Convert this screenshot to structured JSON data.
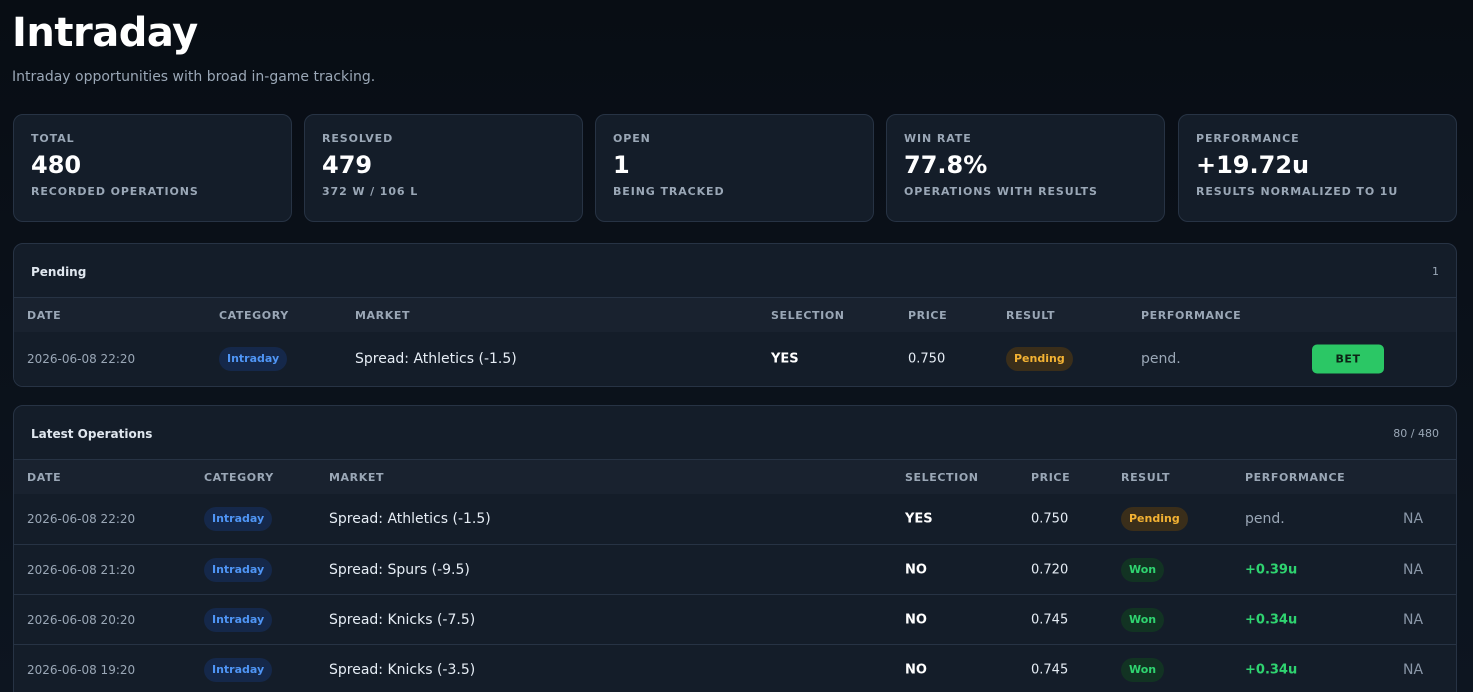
{
  "page": {
    "title": "Intraday",
    "subtitle": "Intraday opportunities with broad in-game tracking."
  },
  "stats": [
    {
      "label": "TOTAL",
      "value": "480",
      "sub": "RECORDED OPERATIONS"
    },
    {
      "label": "RESOLVED",
      "value": "479",
      "sub": "372 W / 106 L"
    },
    {
      "label": "OPEN",
      "value": "1",
      "sub": "BEING TRACKED"
    },
    {
      "label": "WIN RATE",
      "value": "77.8%",
      "sub": "OPERATIONS WITH RESULTS"
    },
    {
      "label": "PERFORMANCE",
      "value": "+19.72u",
      "sub": "RESULTS NORMALIZED TO 1U"
    }
  ],
  "pending": {
    "title": "Pending",
    "count": "1",
    "columns": [
      "DATE",
      "CATEGORY",
      "MARKET",
      "SELECTION",
      "PRICE",
      "RESULT",
      "PERFORMANCE"
    ],
    "rows": [
      {
        "date": "2026-06-08 22:20",
        "category": "Intraday",
        "market": "Spread: Athletics (-1.5)",
        "selection": "YES",
        "price": "0.750",
        "result": "Pending",
        "performance": "pend.",
        "action": "BET"
      }
    ]
  },
  "latest": {
    "title": "Latest Operations",
    "count": "80 / 480",
    "columns": [
      "DATE",
      "CATEGORY",
      "MARKET",
      "SELECTION",
      "PRICE",
      "RESULT",
      "PERFORMANCE"
    ],
    "rows": [
      {
        "date": "2026-06-08 22:20",
        "category": "Intraday",
        "market": "Spread: Athletics (-1.5)",
        "selection": "YES",
        "price": "0.750",
        "result": "Pending",
        "performance": "pend.",
        "extra": "NA"
      },
      {
        "date": "2026-06-08 21:20",
        "category": "Intraday",
        "market": "Spread: Spurs (-9.5)",
        "selection": "NO",
        "price": "0.720",
        "result": "Won",
        "performance": "+0.39u",
        "extra": "NA"
      },
      {
        "date": "2026-06-08 20:20",
        "category": "Intraday",
        "market": "Spread: Knicks (-7.5)",
        "selection": "NO",
        "price": "0.745",
        "result": "Won",
        "performance": "+0.34u",
        "extra": "NA"
      },
      {
        "date": "2026-06-08 19:20",
        "category": "Intraday",
        "market": "Spread: Knicks (-3.5)",
        "selection": "NO",
        "price": "0.745",
        "result": "Won",
        "performance": "+0.34u",
        "extra": "NA"
      }
    ]
  },
  "colors": {
    "accent_blue": "#4f95f5",
    "pending_amber": "#f3b233",
    "won_green": "#2fd470",
    "bet_button": "#2bc765"
  }
}
